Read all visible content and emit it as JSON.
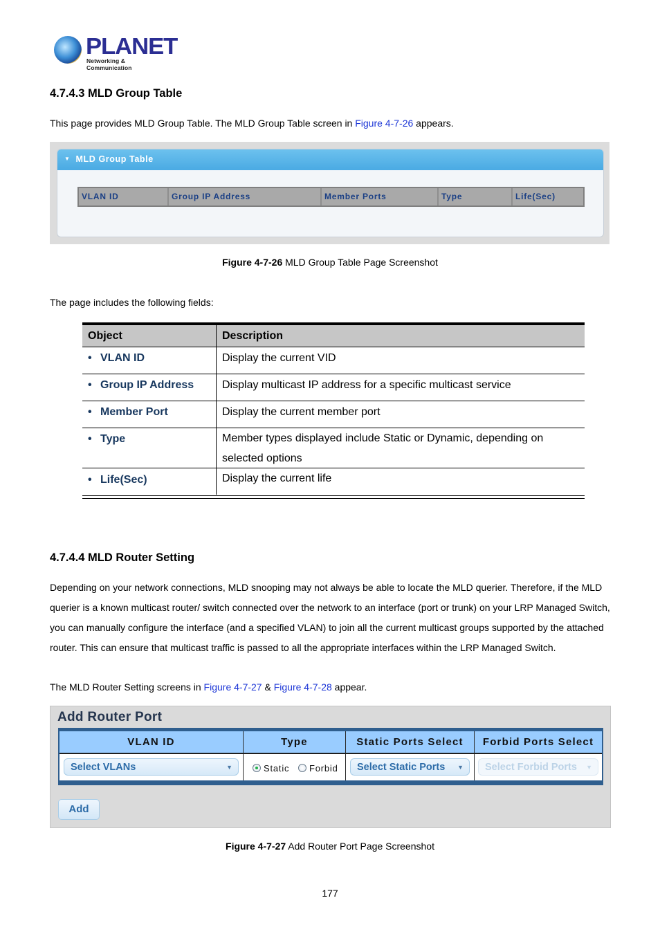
{
  "logo": {
    "brand": "PLANET",
    "tagline": "Networking & Communication"
  },
  "section1": {
    "heading": "4.7.4.3 MLD Group Table",
    "intro_before_link": "This page provides MLD Group Table. The MLD Group Table screen in ",
    "intro_link": "Figure 4-7-26",
    "intro_after_link": " appears."
  },
  "figure1": {
    "panel_title": "MLD Group Table",
    "columns": [
      "VLAN ID",
      "Group IP Address",
      "Member Ports",
      "Type",
      "Life(Sec)"
    ],
    "caption_bold": "Figure 4-7-26",
    "caption_text": " MLD Group Table Page Screenshot"
  },
  "fields_intro": "The page includes the following fields:",
  "fields_table": {
    "headers": [
      "Object",
      "Description"
    ],
    "rows": [
      {
        "object": "VLAN ID",
        "description": "Display the current VID"
      },
      {
        "object": "Group IP Address",
        "description": "Display multicast IP address for a specific multicast service"
      },
      {
        "object": "Member Port",
        "description": "Display the current member port"
      },
      {
        "object": "Type",
        "description": "Member types displayed include Static or Dynamic, depending on selected options"
      },
      {
        "object": "Life(Sec)",
        "description": "Display the current life"
      }
    ]
  },
  "section2": {
    "heading": "4.7.4.4 MLD Router Setting",
    "paragraph": "Depending on your network connections, MLD snooping may not always be able to locate the MLD querier. Therefore, if the MLD querier is a known multicast router/ switch connected over the network to an interface (port or trunk) on your LRP Managed Switch, you can manually configure the interface (and a specified VLAN) to join all the current multicast groups supported by the attached router. This can ensure that multicast traffic is passed to all the appropriate interfaces within the LRP Managed Switch.",
    "screens_before": "The MLD Router Setting screens in ",
    "screens_link1": "Figure 4-7-27",
    "screens_amp": " & ",
    "screens_link2": "Figure 4-7-28",
    "screens_after": " appear."
  },
  "figure3": {
    "title": "Add Router Port",
    "columns": [
      "VLAN ID",
      "Type",
      "Static Ports Select",
      "Forbid Ports Select"
    ],
    "vlan_select": "Select VLANs",
    "type_options": [
      {
        "label": "Static",
        "selected": true
      },
      {
        "label": "Forbid",
        "selected": false
      }
    ],
    "static_ports_select": "Select Static Ports",
    "forbid_ports_select": "Select Forbid Ports",
    "forbid_ports_disabled": true,
    "add_button": "Add",
    "caption_bold": "Figure 4-7-27",
    "caption_text": " Add Router Port Page Screenshot"
  },
  "page_number": "177"
}
